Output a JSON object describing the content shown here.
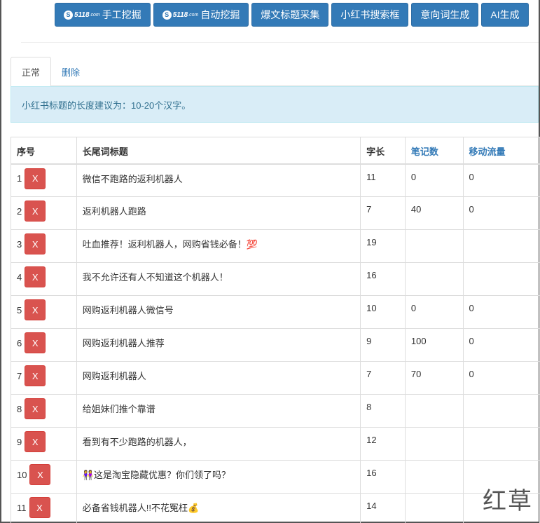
{
  "toolbar": {
    "buttons": [
      {
        "label": "手工挖掘",
        "logo": "5118"
      },
      {
        "label": "自动挖掘",
        "logo": "5118"
      },
      {
        "label": "爆文标题采集"
      },
      {
        "label": "小红书搜索框"
      },
      {
        "label": "意向词生成"
      },
      {
        "label": "AI生成"
      }
    ],
    "logo_suffix": ".com"
  },
  "tabs": [
    {
      "label": "正常",
      "active": true
    },
    {
      "label": "删除",
      "active": false
    }
  ],
  "alert": "小红书标题的长度建议为：10-20个汉字。",
  "table": {
    "headers": [
      "序号",
      "长尾词标题",
      "字长",
      "笔记数",
      "移动流量"
    ],
    "delete_label": "X",
    "rows": [
      {
        "n": "1",
        "title": "微信不跑路的返利机器人",
        "len": "11",
        "notes": "0",
        "traffic": "0"
      },
      {
        "n": "2",
        "title": "返利机器人跑路",
        "len": "7",
        "notes": "40",
        "traffic": "0"
      },
      {
        "n": "3",
        "title": "吐血推荐！返利机器人，网购省钱必备！💯",
        "len": "19",
        "notes": "",
        "traffic": ""
      },
      {
        "n": "4",
        "title": "我不允许还有人不知道这个机器人！",
        "len": "16",
        "notes": "",
        "traffic": ""
      },
      {
        "n": "5",
        "title": "网购返利机器人微信号",
        "len": "10",
        "notes": "0",
        "traffic": "0"
      },
      {
        "n": "6",
        "title": "网购返利机器人推荐",
        "len": "9",
        "notes": "100",
        "traffic": "0"
      },
      {
        "n": "7",
        "title": "网购返利机器人",
        "len": "7",
        "notes": "70",
        "traffic": "0"
      },
      {
        "n": "8",
        "title": "给姐妹们推个靠谱",
        "len": "8",
        "notes": "",
        "traffic": ""
      },
      {
        "n": "9",
        "title": "看到有不少跑路的机器人，",
        "len": "12",
        "notes": "",
        "traffic": ""
      },
      {
        "n": "10",
        "title": "👭这是淘宝隐藏优惠？你们领了吗？",
        "len": "16",
        "notes": "",
        "traffic": ""
      },
      {
        "n": "11",
        "title": "必备省钱机器人!!不花冤枉💰",
        "len": "14",
        "notes": "",
        "traffic": ""
      }
    ]
  },
  "watermark": "红草",
  "colors": {
    "primary": "#337ab7",
    "danger": "#d9534f",
    "info_bg": "#d9edf7",
    "info_text": "#31708f"
  }
}
